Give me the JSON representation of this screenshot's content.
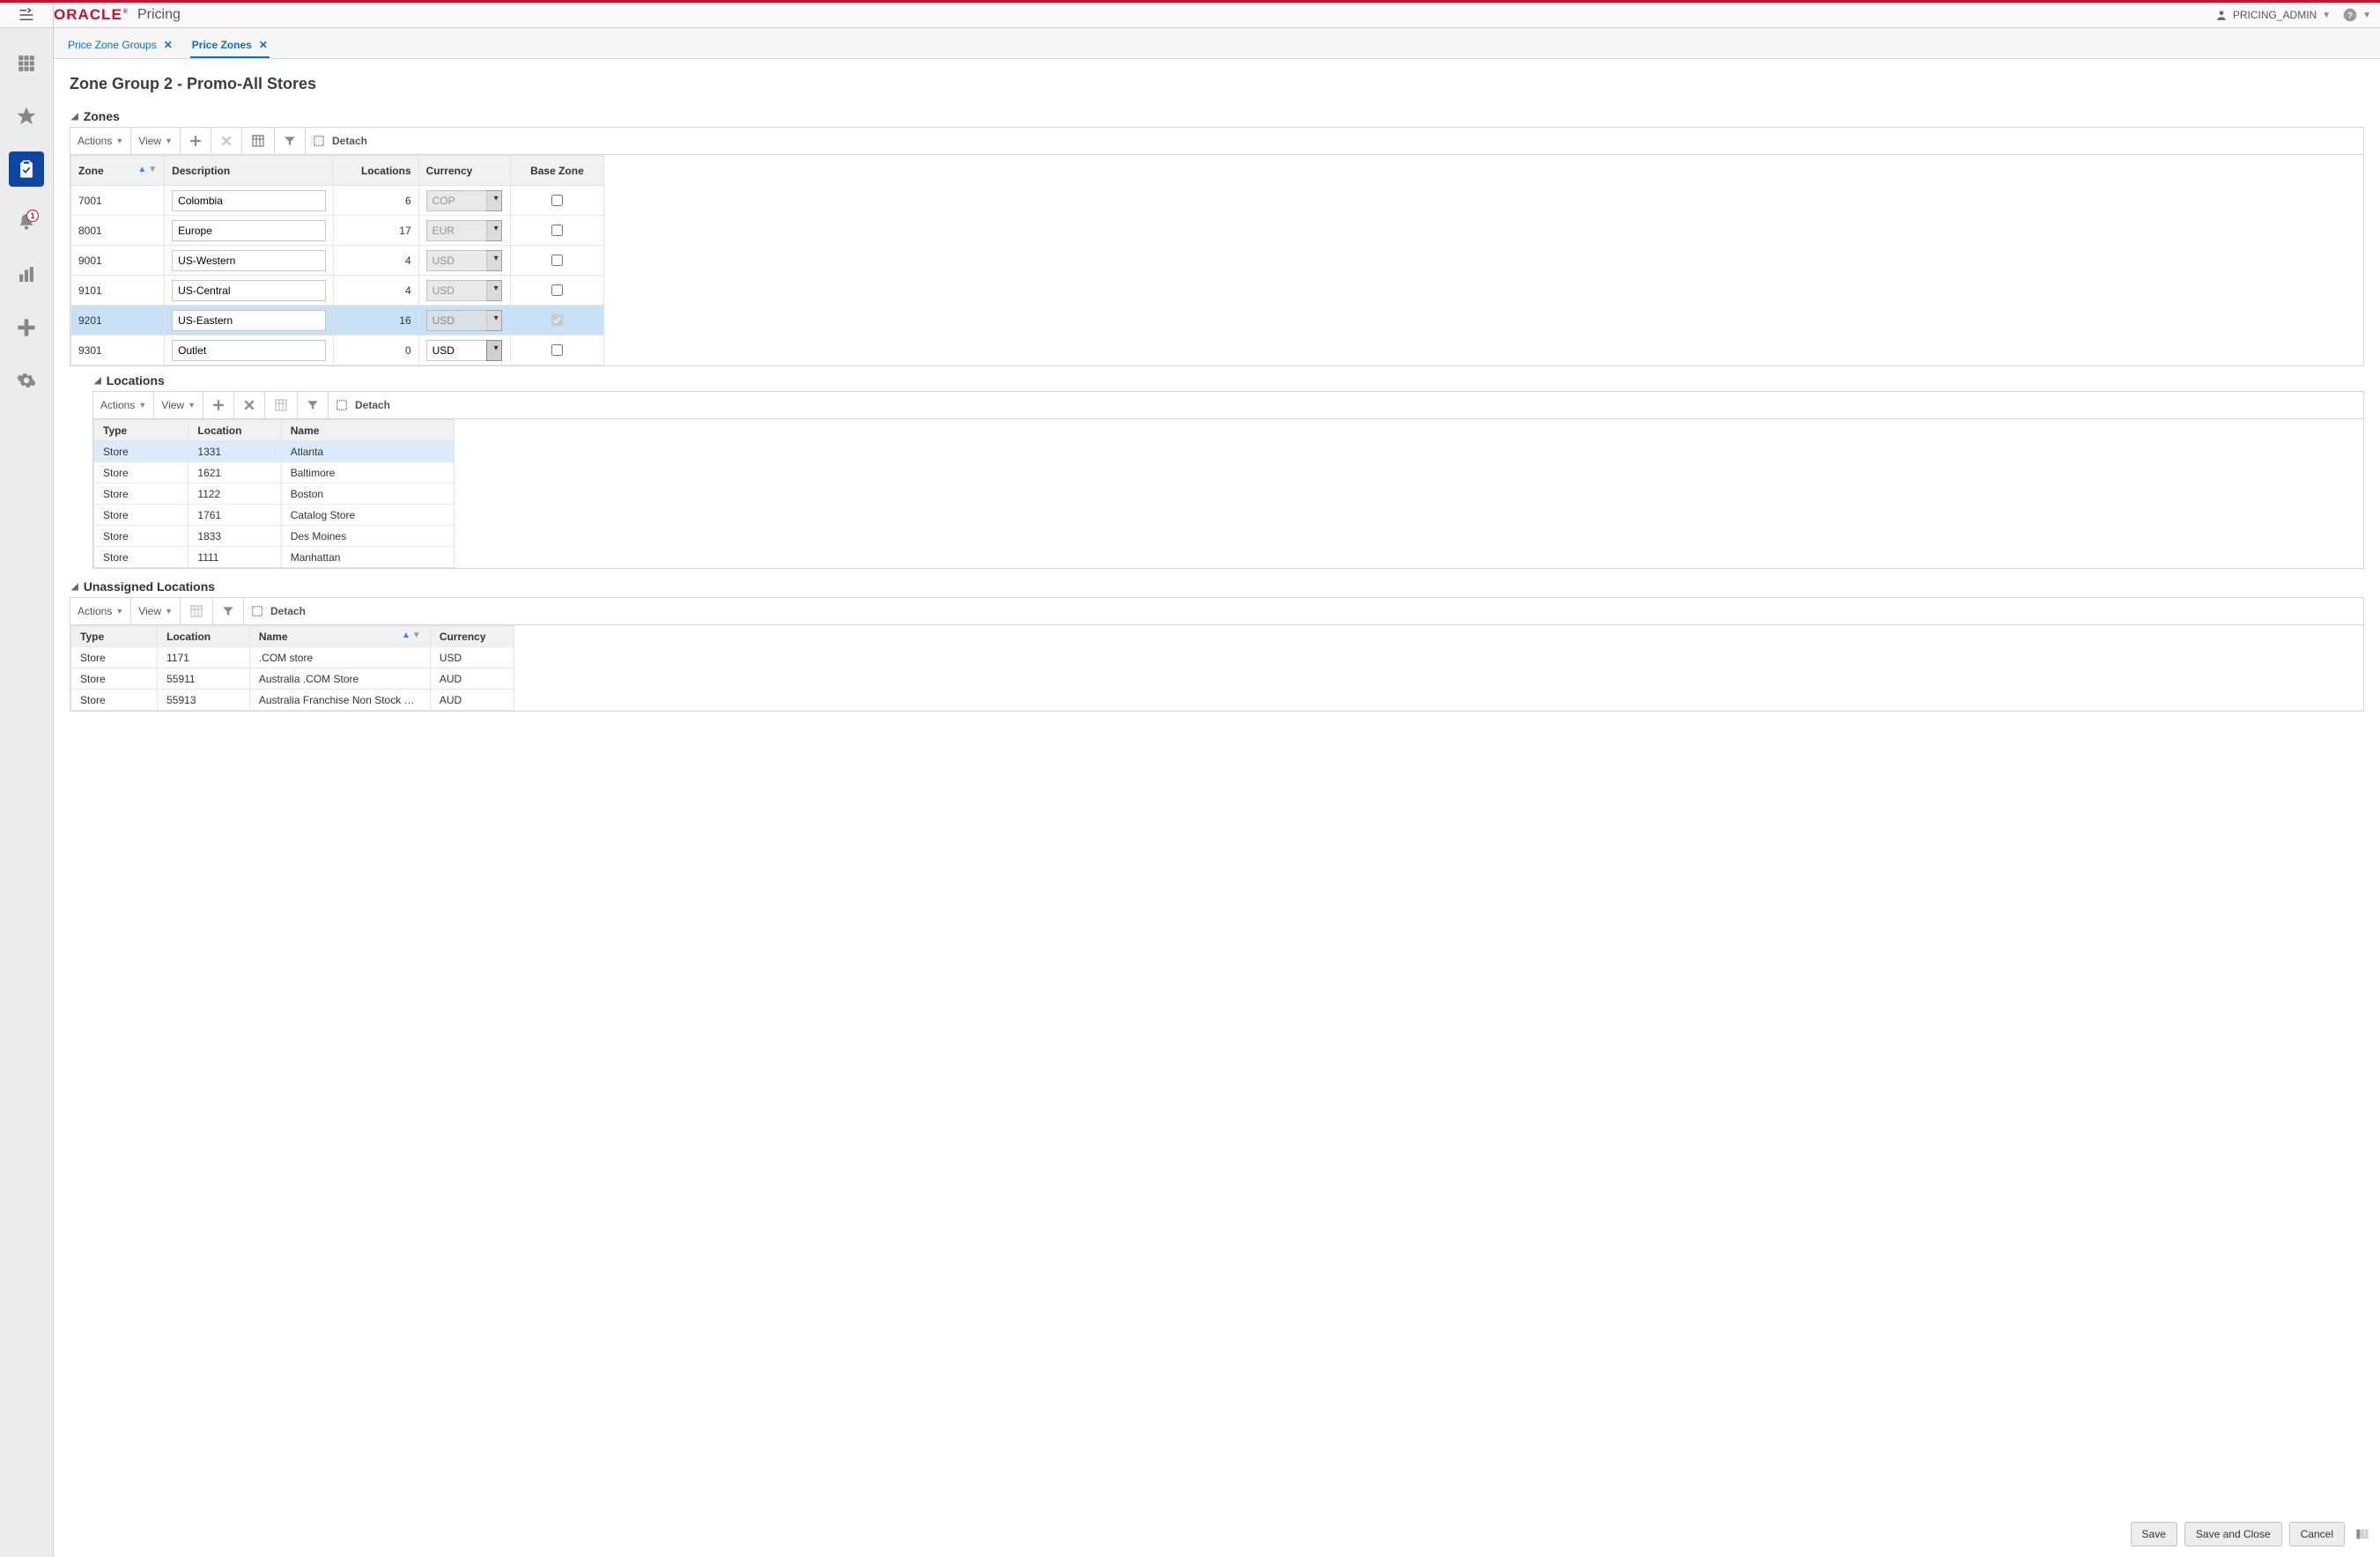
{
  "header": {
    "logo_text": "ORACLE",
    "app_name": "Pricing",
    "user": "PRICING_ADMIN"
  },
  "rail": {
    "items": [
      {
        "name": "home-grid-icon",
        "selected": false
      },
      {
        "name": "favorites-icon",
        "selected": false
      },
      {
        "name": "tasks-icon",
        "selected": true
      },
      {
        "name": "notifications-icon",
        "selected": false,
        "badge": "1"
      },
      {
        "name": "reports-icon",
        "selected": false
      },
      {
        "name": "add-icon",
        "selected": false
      },
      {
        "name": "settings-icon",
        "selected": false
      }
    ]
  },
  "tabs": [
    {
      "label": "Price Zone Groups",
      "active": false
    },
    {
      "label": "Price Zones",
      "active": true
    }
  ],
  "page": {
    "title": "Zone Group 2 - Promo-All Stores"
  },
  "toolbar_labels": {
    "actions": "Actions",
    "view": "View",
    "detach": "Detach"
  },
  "zones": {
    "title": "Zones",
    "columns": {
      "zone": "Zone",
      "description": "Description",
      "locations": "Locations",
      "currency": "Currency",
      "base": "Base Zone"
    },
    "rows": [
      {
        "zone": "7001",
        "description": "Colombia",
        "locations": 6,
        "currency": "COP",
        "curr_disabled": true,
        "base": false,
        "selected": false
      },
      {
        "zone": "8001",
        "description": "Europe",
        "locations": 17,
        "currency": "EUR",
        "curr_disabled": true,
        "base": false,
        "selected": false
      },
      {
        "zone": "9001",
        "description": "US-Western",
        "locations": 4,
        "currency": "USD",
        "curr_disabled": true,
        "base": false,
        "selected": false
      },
      {
        "zone": "9101",
        "description": "US-Central",
        "locations": 4,
        "currency": "USD",
        "curr_disabled": true,
        "base": false,
        "selected": false
      },
      {
        "zone": "9201",
        "description": "US-Eastern",
        "locations": 16,
        "currency": "USD",
        "curr_disabled": true,
        "base": true,
        "base_disabled": true,
        "selected": true
      },
      {
        "zone": "9301",
        "description": "Outlet",
        "locations": 0,
        "currency": "USD",
        "curr_disabled": false,
        "base": false,
        "selected": false
      }
    ]
  },
  "locations": {
    "title": "Locations",
    "columns": {
      "type": "Type",
      "location": "Location",
      "name": "Name"
    },
    "rows": [
      {
        "type": "Store",
        "location": "1331",
        "name": "Atlanta",
        "selected": true
      },
      {
        "type": "Store",
        "location": "1621",
        "name": "Baltimore"
      },
      {
        "type": "Store",
        "location": "1122",
        "name": "Boston"
      },
      {
        "type": "Store",
        "location": "1761",
        "name": "Catalog Store"
      },
      {
        "type": "Store",
        "location": "1833",
        "name": "Des Moines"
      },
      {
        "type": "Store",
        "location": "1111",
        "name": "Manhattan"
      }
    ]
  },
  "unassigned": {
    "title": "Unassigned Locations",
    "columns": {
      "type": "Type",
      "location": "Location",
      "name": "Name",
      "currency": "Currency"
    },
    "rows": [
      {
        "type": "Store",
        "location": "1171",
        "name": ".COM store",
        "currency": "USD"
      },
      {
        "type": "Store",
        "location": "55911",
        "name": "Australia .COM Store",
        "currency": "AUD"
      },
      {
        "type": "Store",
        "location": "55913",
        "name": "Australia Franchise Non Stock Hol...",
        "currency": "AUD"
      }
    ]
  },
  "footer": {
    "save": "Save",
    "save_close": "Save and Close",
    "cancel": "Cancel"
  }
}
